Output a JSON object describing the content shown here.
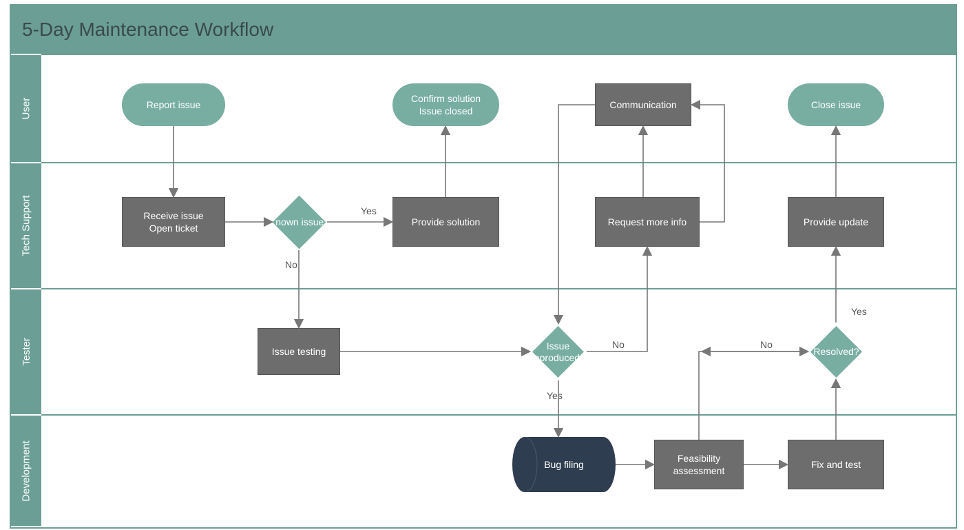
{
  "title": "5-Day Maintenance Workflow",
  "lanes": {
    "user": "User",
    "tech_support": "Tech Support",
    "tester": "Tester",
    "development": "Development"
  },
  "nodes": {
    "report_issue": "Report issue",
    "confirm_solution": "Confirm solution\nIssue closed",
    "communication": "Communication",
    "close_issue": "Close issue",
    "receive_issue": "Receive issue\nOpen ticket",
    "known_issue": "Known issue?",
    "provide_solution": "Provide solution",
    "request_more_info": "Request more info",
    "provide_update": "Provide update",
    "issue_testing": "Issue testing",
    "issue_reproduced": "Issue\nreproduced?",
    "resolved": "Resolved?",
    "bug_filing": "Bug filing",
    "feasibility": "Feasibility\nassessment",
    "fix_and_test": "Fix and test"
  },
  "labels": {
    "yes": "Yes",
    "no": "No"
  },
  "colors": {
    "lane": "#6b9f95",
    "process": "#6d6d6d",
    "terminator": "#78aea2",
    "decision": "#78aea2",
    "cylinder": "#2e3d4f",
    "connector": "#777"
  }
}
